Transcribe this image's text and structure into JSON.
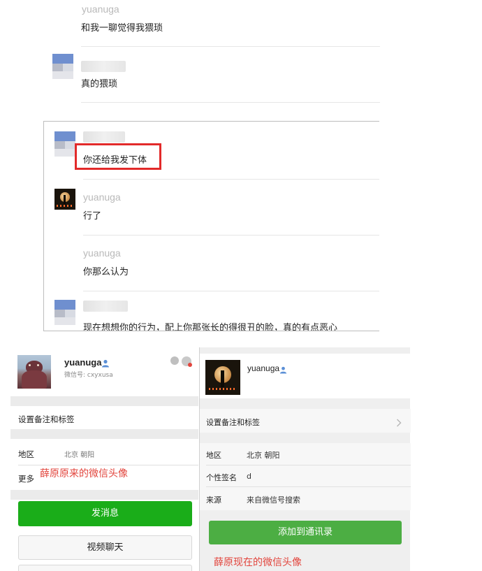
{
  "chat": {
    "messages": [
      {
        "name": "yuanuga",
        "text": "和我一聊觉得我猥琐"
      },
      {
        "name": "",
        "text": "真的猥琐"
      },
      {
        "name": "",
        "text": "你还给我发下体"
      },
      {
        "name": "yuanuga",
        "text": "行了"
      },
      {
        "name": "yuanuga",
        "text": "你那么认为"
      },
      {
        "name": "",
        "text": "现在想想你的行为，配上你那张长的得很丑的脸，真的有点恶心"
      }
    ]
  },
  "left_profile": {
    "name": "yuanuga",
    "wechat_id": "微信号: cxyxusa",
    "set_remark": "设置备注和标签",
    "region_label": "地区",
    "region_value": "北京 朝阳",
    "more_label": "更多",
    "caption": "薛原原来的微信头像",
    "send_message": "发消息",
    "video_call": "视频聊天"
  },
  "right_profile": {
    "name": "yuanuga",
    "set_remark": "设置备注和标签",
    "region_label": "地区",
    "region_value": "北京 朝阳",
    "signature_label": "个性签名",
    "signature_value": "d",
    "source_label": "来源",
    "source_value": "来自微信号搜索",
    "add_contact": "添加到通讯录",
    "caption": "薛原现在的微信头像"
  },
  "colors": {
    "highlight_border": "#e22a2a",
    "caption_red": "#e2453d",
    "send_green": "#1aad19",
    "add_green": "#4cae43"
  },
  "icons": {
    "male_badge": "person-icon",
    "chevron": "chevron-right-icon"
  }
}
